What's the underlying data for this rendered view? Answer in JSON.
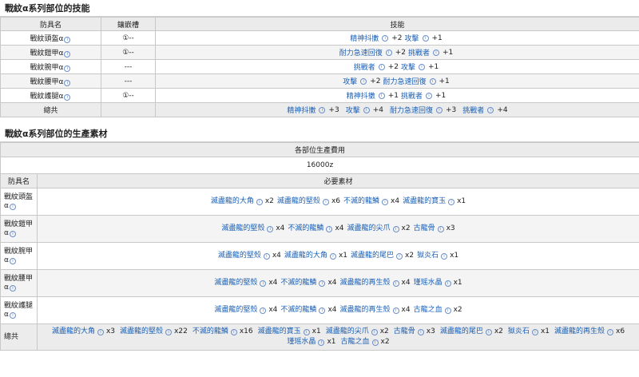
{
  "section1_title": "戰紋α系列部位的技能",
  "table1": {
    "headers": [
      "防具名",
      "鑲嵌槽",
      "技能"
    ],
    "rows": [
      {
        "name": "戰紋頭盔α",
        "slot": "①--",
        "skills": [
          {
            "n": "精神抖擻",
            "v": "+2"
          },
          {
            "n": "攻擊",
            "v": "+1"
          }
        ]
      },
      {
        "name": "戰紋鎧甲α",
        "slot": "①--",
        "skills": [
          {
            "n": "耐力急速回復",
            "v": "+2"
          },
          {
            "n": "挑戰者",
            "v": "+1"
          }
        ]
      },
      {
        "name": "戰紋腕甲α",
        "slot": "---",
        "skills": [
          {
            "n": "挑戰者",
            "v": "+2"
          },
          {
            "n": "攻擊",
            "v": "+1"
          }
        ]
      },
      {
        "name": "戰紋腰甲α",
        "slot": "---",
        "skills": [
          {
            "n": "攻擊",
            "v": "+2"
          },
          {
            "n": "耐力急速回復",
            "v": "+1"
          }
        ]
      },
      {
        "name": "戰紋護腿α",
        "slot": "①--",
        "skills": [
          {
            "n": "精神抖擻",
            "v": "+1"
          },
          {
            "n": "挑戰者",
            "v": "+1"
          }
        ]
      }
    ],
    "total": {
      "name": "總共",
      "skills": [
        {
          "n": "精神抖擻",
          "v": "+3"
        },
        {
          "n": "攻擊",
          "v": "+4"
        },
        {
          "n": "耐力急速回復",
          "v": "+3"
        },
        {
          "n": "挑戰者",
          "v": "+4"
        }
      ]
    }
  },
  "section2_title": "戰紋α系列部位的生產素材",
  "table2": {
    "cost_header": "各部位生產費用",
    "cost_value": "16000z",
    "headers": [
      "防具名",
      "必要素材"
    ],
    "rows": [
      {
        "name1": "戰紋頭盔",
        "name2": "α",
        "mats": [
          {
            "n": "滅盡龍的大角",
            "v": "x2"
          },
          {
            "n": "滅盡龍的堅殼",
            "v": "x6"
          },
          {
            "n": "不滅的龍鱗",
            "v": "x4"
          },
          {
            "n": "滅盡龍的寶玉",
            "v": "x1"
          }
        ]
      },
      {
        "name1": "戰紋鎧甲",
        "name2": "α",
        "mats": [
          {
            "n": "滅盡龍的堅殼",
            "v": "x4"
          },
          {
            "n": "不滅的龍鱗",
            "v": "x4"
          },
          {
            "n": "滅盡龍的尖爪",
            "v": "x2"
          },
          {
            "n": "古龍骨",
            "v": "x3"
          }
        ]
      },
      {
        "name1": "戰紋腕甲",
        "name2": "α",
        "mats": [
          {
            "n": "滅盡龍的堅殼",
            "v": "x4"
          },
          {
            "n": "滅盡龍的大角",
            "v": "x1"
          },
          {
            "n": "滅盡龍的尾巴",
            "v": "x2"
          },
          {
            "n": "獄炎石",
            "v": "x1"
          }
        ]
      },
      {
        "name1": "戰紋腰甲",
        "name2": "α",
        "mats": [
          {
            "n": "滅盡龍的堅殼",
            "v": "x4"
          },
          {
            "n": "不滅的龍鱗",
            "v": "x4"
          },
          {
            "n": "滅盡龍的再生殼",
            "v": "x4"
          },
          {
            "n": "瑾瑶水晶",
            "v": "x1"
          }
        ]
      },
      {
        "name1": "戰紋護腿",
        "name2": "α",
        "mats": [
          {
            "n": "滅盡龍的堅殼",
            "v": "x4"
          },
          {
            "n": "不滅的龍鱗",
            "v": "x4"
          },
          {
            "n": "滅盡龍的再生殼",
            "v": "x4"
          },
          {
            "n": "古龍之血",
            "v": "x2"
          }
        ]
      }
    ],
    "total": {
      "name": "總共",
      "mats": [
        {
          "n": "滅盡龍的大角",
          "v": "x3"
        },
        {
          "n": "滅盡龍的堅殼",
          "v": "x22"
        },
        {
          "n": "不滅的龍鱗",
          "v": "x16"
        },
        {
          "n": "滅盡龍的寶玉",
          "v": "x1"
        },
        {
          "n": "滅盡龍的尖爪",
          "v": "x2"
        },
        {
          "n": "古龍骨",
          "v": "x3"
        },
        {
          "n": "滅盡龍的尾巴",
          "v": "x2"
        },
        {
          "n": "獄炎石",
          "v": "x1"
        },
        {
          "n": "滅盡龍的再生殼",
          "v": "x6"
        },
        {
          "n": "瑾瑶水晶",
          "v": "x1"
        },
        {
          "n": "古龍之血",
          "v": "x2"
        }
      ]
    }
  }
}
